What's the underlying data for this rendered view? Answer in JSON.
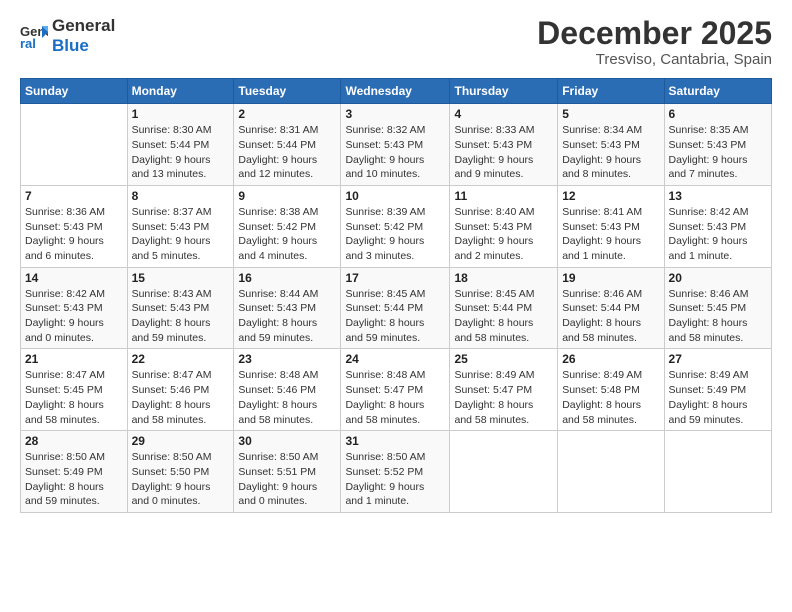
{
  "logo": {
    "line1": "General",
    "line2": "Blue"
  },
  "title": "December 2025",
  "subtitle": "Tresviso, Cantabria, Spain",
  "days_of_week": [
    "Sunday",
    "Monday",
    "Tuesday",
    "Wednesday",
    "Thursday",
    "Friday",
    "Saturday"
  ],
  "weeks": [
    [
      {
        "day": "",
        "sunrise": "",
        "sunset": "",
        "daylight": ""
      },
      {
        "day": "1",
        "sunrise": "Sunrise: 8:30 AM",
        "sunset": "Sunset: 5:44 PM",
        "daylight": "Daylight: 9 hours and 13 minutes."
      },
      {
        "day": "2",
        "sunrise": "Sunrise: 8:31 AM",
        "sunset": "Sunset: 5:44 PM",
        "daylight": "Daylight: 9 hours and 12 minutes."
      },
      {
        "day": "3",
        "sunrise": "Sunrise: 8:32 AM",
        "sunset": "Sunset: 5:43 PM",
        "daylight": "Daylight: 9 hours and 10 minutes."
      },
      {
        "day": "4",
        "sunrise": "Sunrise: 8:33 AM",
        "sunset": "Sunset: 5:43 PM",
        "daylight": "Daylight: 9 hours and 9 minutes."
      },
      {
        "day": "5",
        "sunrise": "Sunrise: 8:34 AM",
        "sunset": "Sunset: 5:43 PM",
        "daylight": "Daylight: 9 hours and 8 minutes."
      },
      {
        "day": "6",
        "sunrise": "Sunrise: 8:35 AM",
        "sunset": "Sunset: 5:43 PM",
        "daylight": "Daylight: 9 hours and 7 minutes."
      }
    ],
    [
      {
        "day": "7",
        "sunrise": "Sunrise: 8:36 AM",
        "sunset": "Sunset: 5:43 PM",
        "daylight": "Daylight: 9 hours and 6 minutes."
      },
      {
        "day": "8",
        "sunrise": "Sunrise: 8:37 AM",
        "sunset": "Sunset: 5:43 PM",
        "daylight": "Daylight: 9 hours and 5 minutes."
      },
      {
        "day": "9",
        "sunrise": "Sunrise: 8:38 AM",
        "sunset": "Sunset: 5:42 PM",
        "daylight": "Daylight: 9 hours and 4 minutes."
      },
      {
        "day": "10",
        "sunrise": "Sunrise: 8:39 AM",
        "sunset": "Sunset: 5:42 PM",
        "daylight": "Daylight: 9 hours and 3 minutes."
      },
      {
        "day": "11",
        "sunrise": "Sunrise: 8:40 AM",
        "sunset": "Sunset: 5:43 PM",
        "daylight": "Daylight: 9 hours and 2 minutes."
      },
      {
        "day": "12",
        "sunrise": "Sunrise: 8:41 AM",
        "sunset": "Sunset: 5:43 PM",
        "daylight": "Daylight: 9 hours and 1 minute."
      },
      {
        "day": "13",
        "sunrise": "Sunrise: 8:42 AM",
        "sunset": "Sunset: 5:43 PM",
        "daylight": "Daylight: 9 hours and 1 minute."
      }
    ],
    [
      {
        "day": "14",
        "sunrise": "Sunrise: 8:42 AM",
        "sunset": "Sunset: 5:43 PM",
        "daylight": "Daylight: 9 hours and 0 minutes."
      },
      {
        "day": "15",
        "sunrise": "Sunrise: 8:43 AM",
        "sunset": "Sunset: 5:43 PM",
        "daylight": "Daylight: 8 hours and 59 minutes."
      },
      {
        "day": "16",
        "sunrise": "Sunrise: 8:44 AM",
        "sunset": "Sunset: 5:43 PM",
        "daylight": "Daylight: 8 hours and 59 minutes."
      },
      {
        "day": "17",
        "sunrise": "Sunrise: 8:45 AM",
        "sunset": "Sunset: 5:44 PM",
        "daylight": "Daylight: 8 hours and 59 minutes."
      },
      {
        "day": "18",
        "sunrise": "Sunrise: 8:45 AM",
        "sunset": "Sunset: 5:44 PM",
        "daylight": "Daylight: 8 hours and 58 minutes."
      },
      {
        "day": "19",
        "sunrise": "Sunrise: 8:46 AM",
        "sunset": "Sunset: 5:44 PM",
        "daylight": "Daylight: 8 hours and 58 minutes."
      },
      {
        "day": "20",
        "sunrise": "Sunrise: 8:46 AM",
        "sunset": "Sunset: 5:45 PM",
        "daylight": "Daylight: 8 hours and 58 minutes."
      }
    ],
    [
      {
        "day": "21",
        "sunrise": "Sunrise: 8:47 AM",
        "sunset": "Sunset: 5:45 PM",
        "daylight": "Daylight: 8 hours and 58 minutes."
      },
      {
        "day": "22",
        "sunrise": "Sunrise: 8:47 AM",
        "sunset": "Sunset: 5:46 PM",
        "daylight": "Daylight: 8 hours and 58 minutes."
      },
      {
        "day": "23",
        "sunrise": "Sunrise: 8:48 AM",
        "sunset": "Sunset: 5:46 PM",
        "daylight": "Daylight: 8 hours and 58 minutes."
      },
      {
        "day": "24",
        "sunrise": "Sunrise: 8:48 AM",
        "sunset": "Sunset: 5:47 PM",
        "daylight": "Daylight: 8 hours and 58 minutes."
      },
      {
        "day": "25",
        "sunrise": "Sunrise: 8:49 AM",
        "sunset": "Sunset: 5:47 PM",
        "daylight": "Daylight: 8 hours and 58 minutes."
      },
      {
        "day": "26",
        "sunrise": "Sunrise: 8:49 AM",
        "sunset": "Sunset: 5:48 PM",
        "daylight": "Daylight: 8 hours and 58 minutes."
      },
      {
        "day": "27",
        "sunrise": "Sunrise: 8:49 AM",
        "sunset": "Sunset: 5:49 PM",
        "daylight": "Daylight: 8 hours and 59 minutes."
      }
    ],
    [
      {
        "day": "28",
        "sunrise": "Sunrise: 8:50 AM",
        "sunset": "Sunset: 5:49 PM",
        "daylight": "Daylight: 8 hours and 59 minutes."
      },
      {
        "day": "29",
        "sunrise": "Sunrise: 8:50 AM",
        "sunset": "Sunset: 5:50 PM",
        "daylight": "Daylight: 9 hours and 0 minutes."
      },
      {
        "day": "30",
        "sunrise": "Sunrise: 8:50 AM",
        "sunset": "Sunset: 5:51 PM",
        "daylight": "Daylight: 9 hours and 0 minutes."
      },
      {
        "day": "31",
        "sunrise": "Sunrise: 8:50 AM",
        "sunset": "Sunset: 5:52 PM",
        "daylight": "Daylight: 9 hours and 1 minute."
      },
      {
        "day": "",
        "sunrise": "",
        "sunset": "",
        "daylight": ""
      },
      {
        "day": "",
        "sunrise": "",
        "sunset": "",
        "daylight": ""
      },
      {
        "day": "",
        "sunrise": "",
        "sunset": "",
        "daylight": ""
      }
    ]
  ]
}
